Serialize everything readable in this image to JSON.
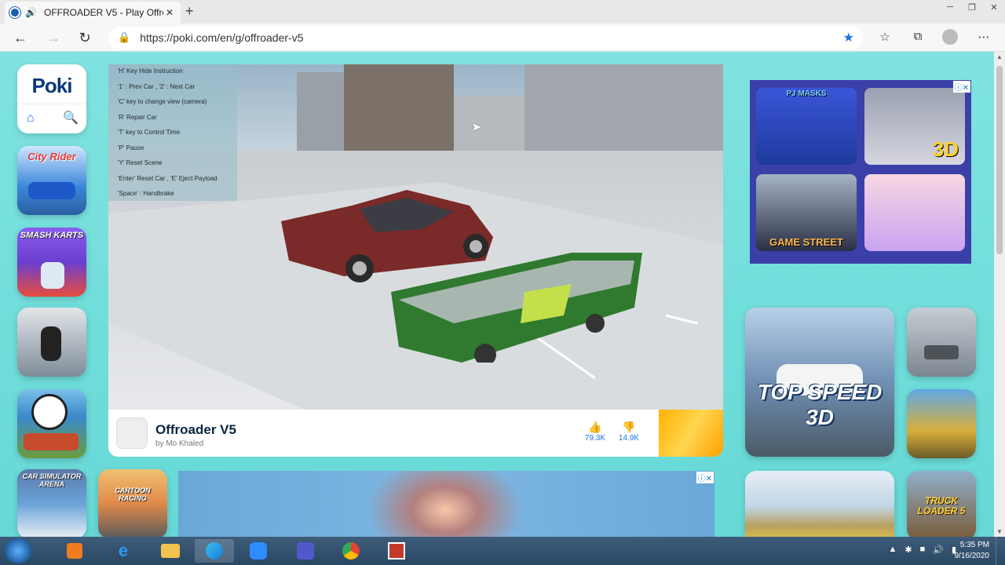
{
  "browser": {
    "tab_title": "OFFROADER V5 - Play Offro",
    "url": "https://poki.com/en/g/offroader-v5",
    "back_icon": "arrow-left",
    "reload_icon": "reload",
    "bookmark_icon": "star-filled"
  },
  "site": {
    "logo_text": "Poki"
  },
  "sidebar_games": [
    {
      "label": "City Rider",
      "color": "#3a86d8"
    },
    {
      "label": "SMASH KARTS",
      "color": "#6b3fd0"
    },
    {
      "label": "",
      "color": "#7e8b97"
    },
    {
      "label": "",
      "color": "#c74a2d"
    },
    {
      "label": "CAR SIMULATOR ARENA",
      "color": "#6aa4d8"
    },
    {
      "label": "CARTOON RACING",
      "color": "#e0894a"
    }
  ],
  "game": {
    "instructions": [
      "'H' Key Hide Instruction",
      "'1' : Prev Car , '2' : Next Car",
      "'C' key to change view (camera)",
      "'R' Repair Car",
      "'T' key to Control Time",
      "'P' Pause",
      "'Y' Reset Scene",
      "'Enter' Reset Car , 'E' Eject Payload",
      "'Space' : Handbrake"
    ],
    "title": "Offroader V5",
    "author": "by Mo Khaled",
    "likes": "79.3K",
    "dislikes": "14.9K"
  },
  "ad_top": {
    "tiles": [
      {
        "label": "PJ MASKS",
        "color": "#1f3a9c"
      },
      {
        "label": "3D",
        "color": "#b9b9c8"
      },
      {
        "label": "GAME STREET",
        "color": "#2a2f46"
      },
      {
        "label": "",
        "color": "#f3c1d3"
      }
    ]
  },
  "right_games": [
    {
      "label": "TOP SPEED 3D",
      "color": "#6f8fb3"
    },
    {
      "label": "",
      "color": "#7b858f"
    },
    {
      "label": "",
      "color": "#d8b03c"
    },
    {
      "label": "",
      "color": "#c2d6e6"
    },
    {
      "label": "TRUCK LOADER 5",
      "color": "#7a5a3a"
    }
  ],
  "taskbar": {
    "time": "5:35 PM",
    "date": "9/16/2020"
  }
}
